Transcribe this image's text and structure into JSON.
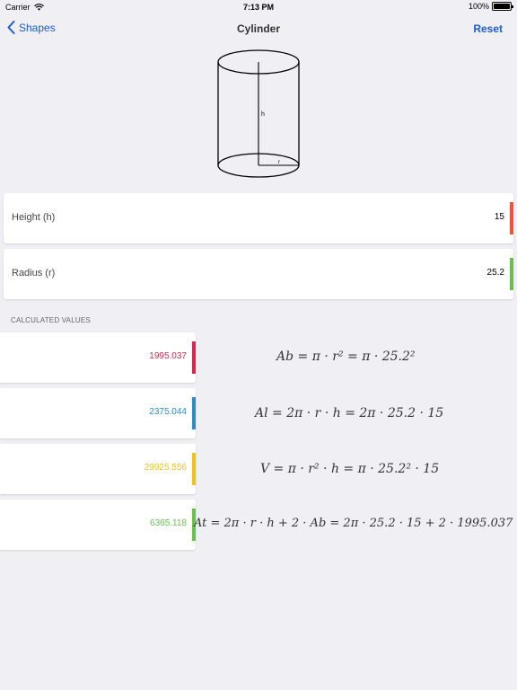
{
  "status_bar": {
    "carrier": "Carrier",
    "time": "7:13 PM",
    "battery": "100%",
    "battery_level": 1.0
  },
  "nav": {
    "back_label": "Shapes",
    "title": "Cylinder",
    "reset_label": "Reset"
  },
  "diagram": {
    "h_label": "h",
    "r_label": "r"
  },
  "inputs": [
    {
      "label": "Height (h)",
      "value": "15",
      "color": "#e8573c"
    },
    {
      "label": "Radius (r)",
      "value": "25.2",
      "color": "#6bbf4e"
    }
  ],
  "section_header": "CALCULATED VALUES",
  "results": [
    {
      "value": "1995.037",
      "color": "#d7264f"
    },
    {
      "value": "2375.044",
      "color": "#2f8bc2"
    },
    {
      "value": "29925.556",
      "color": "#f2c21b"
    },
    {
      "value": "6365.118",
      "color": "#6bbf4e"
    }
  ],
  "formulas": [
    "Ab = π · r² = π · 25.2²",
    "Al = 2π · r · h = 2π · 25.2 · 15",
    "V = π · r² · h = π · 25.2² · 15",
    "At = 2π · r · h + 2 · Ab = 2π · 25.2 · 15 + 2 · 1995.037"
  ],
  "icons": {
    "back": "chevron-left-icon",
    "wifi": "wifi-icon",
    "battery": "battery-icon"
  }
}
